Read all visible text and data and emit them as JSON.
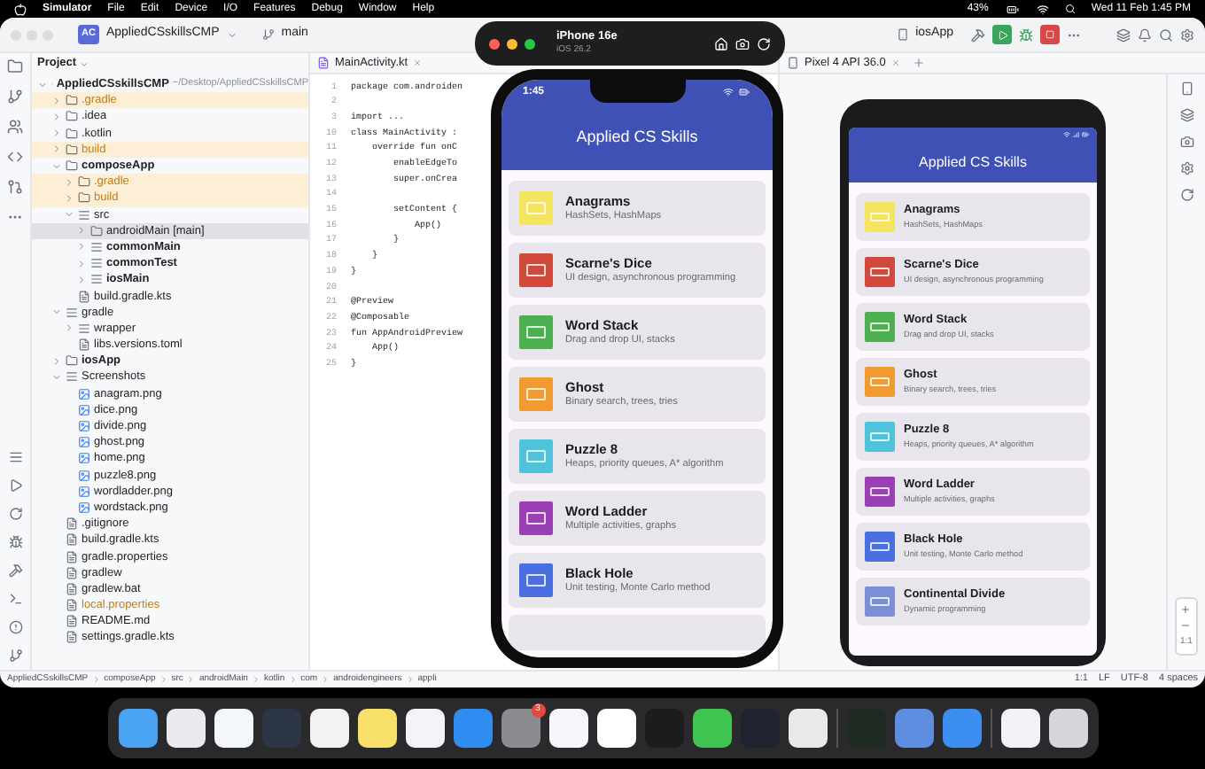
{
  "menu_bar": {
    "app": "Simulator",
    "menus": [
      "File",
      "Edit",
      "Device",
      "I/O",
      "Features",
      "Debug",
      "Window",
      "Help"
    ],
    "battery": "43%",
    "clock": "Wed 11 Feb 1:45 PM"
  },
  "ide": {
    "project_badge": "AC",
    "project": "AppliedCSskillsCMP",
    "branch": "main",
    "run_config": "iosApp",
    "project_panel": {
      "title": "Project",
      "tree": [
        {
          "label": "AppliedCSskillsCMP",
          "note": "~/Desktop/AppliedCSskillsCMP",
          "kind": "module",
          "expanded": true,
          "selected": false,
          "ignored": false,
          "children": [
            {
              "label": ".gradle",
              "kind": "folder",
              "expanded": false,
              "selected": false,
              "ignored": true
            },
            {
              "label": ".idea",
              "kind": "folder",
              "expanded": false,
              "selected": false,
              "ignored": false
            },
            {
              "label": ".kotlin",
              "kind": "folder",
              "expanded": false,
              "selected": false,
              "ignored": false
            },
            {
              "label": "build",
              "kind": "folder",
              "expanded": false,
              "selected": false,
              "ignored": true
            },
            {
              "label": "composeApp",
              "kind": "module",
              "expanded": true,
              "selected": false,
              "ignored": false,
              "children": [
                {
                  "label": ".gradle",
                  "kind": "folder",
                  "expanded": false,
                  "selected": false,
                  "ignored": true
                },
                {
                  "label": "build",
                  "kind": "folder",
                  "expanded": false,
                  "selected": false,
                  "ignored": true
                },
                {
                  "label": "src",
                  "kind": "source",
                  "expanded": true,
                  "selected": false,
                  "ignored": false,
                  "children": [
                    {
                      "label": "androidMain [main]",
                      "kind": "folder",
                      "expanded": false,
                      "selected": true,
                      "ignored": false
                    },
                    {
                      "label": "commonMain",
                      "kind": "source",
                      "expanded": false,
                      "selected": false,
                      "ignored": false
                    },
                    {
                      "label": "commonTest",
                      "kind": "source",
                      "expanded": false,
                      "selected": false,
                      "ignored": false
                    },
                    {
                      "label": "iosMain",
                      "kind": "source",
                      "expanded": false,
                      "selected": false,
                      "ignored": false
                    }
                  ]
                },
                {
                  "label": "build.gradle.kts",
                  "kind": "file",
                  "selected": false,
                  "ignored": false
                }
              ]
            },
            {
              "label": "gradle",
              "kind": "source",
              "expanded": true,
              "selected": false,
              "ignored": false,
              "children": [
                {
                  "label": "wrapper",
                  "kind": "source",
                  "expanded": false,
                  "selected": false,
                  "ignored": false
                },
                {
                  "label": "libs.versions.toml",
                  "kind": "file",
                  "selected": false,
                  "ignored": false
                }
              ]
            },
            {
              "label": "iosApp",
              "kind": "module",
              "expanded": false,
              "selected": false,
              "ignored": false
            },
            {
              "label": "Screenshots",
              "kind": "source",
              "expanded": true,
              "selected": false,
              "ignored": false,
              "children": [
                {
                  "label": "anagram.png",
                  "kind": "image",
                  "selected": false,
                  "ignored": false
                },
                {
                  "label": "dice.png",
                  "kind": "image",
                  "selected": false,
                  "ignored": false
                },
                {
                  "label": "divide.png",
                  "kind": "image",
                  "selected": false,
                  "ignored": false
                },
                {
                  "label": "ghost.png",
                  "kind": "image",
                  "selected": false,
                  "ignored": false
                },
                {
                  "label": "home.png",
                  "kind": "image",
                  "selected": false,
                  "ignored": false
                },
                {
                  "label": "puzzle8.png",
                  "kind": "image",
                  "selected": false,
                  "ignored": false
                },
                {
                  "label": "wordladder.png",
                  "kind": "image",
                  "selected": false,
                  "ignored": false
                },
                {
                  "label": "wordstack.png",
                  "kind": "image",
                  "selected": false,
                  "ignored": false
                }
              ]
            },
            {
              "label": ".gitignore",
              "kind": "file",
              "selected": false,
              "ignored": false
            },
            {
              "label": "build.gradle.kts",
              "kind": "file",
              "selected": false,
              "ignored": false
            },
            {
              "label": "gradle.properties",
              "kind": "file",
              "selected": false,
              "ignored": false
            },
            {
              "label": "gradlew",
              "kind": "file",
              "selected": false,
              "ignored": false
            },
            {
              "label": "gradlew.bat",
              "kind": "file",
              "selected": false,
              "ignored": false
            },
            {
              "label": "local.properties",
              "kind": "file",
              "selected": false,
              "ignored": true
            },
            {
              "label": "README.md",
              "kind": "file",
              "selected": false,
              "ignored": false
            },
            {
              "label": "settings.gradle.kts",
              "kind": "file",
              "selected": false,
              "ignored": false
            }
          ]
        }
      ]
    },
    "editor": {
      "tab": "MainActivity.kt",
      "lines": [
        {
          "number": "1",
          "code": "package com.androiden"
        },
        {
          "number": "2"
        },
        {
          "number": "3",
          "code": "import ..."
        },
        {
          "number": "10",
          "code": "class MainActivity :"
        },
        {
          "number": "11",
          "code": "    override fun onC"
        },
        {
          "number": "12",
          "code": "        enableEdgeTo"
        },
        {
          "number": "13",
          "code": "        super.onCrea"
        },
        {
          "number": "14"
        },
        {
          "number": "15",
          "code": "        setContent {"
        },
        {
          "number": "16",
          "code": "            App()"
        },
        {
          "number": "17",
          "code": "        }"
        },
        {
          "number": "18",
          "code": "    }"
        },
        {
          "number": "19",
          "code": "}"
        },
        {
          "number": "20"
        },
        {
          "number": "21",
          "code": "@Preview"
        },
        {
          "number": "22",
          "code": "@Composable"
        },
        {
          "number": "23",
          "code": "fun AppAndroidPreview"
        },
        {
          "number": "24",
          "code": "    App()"
        },
        {
          "number": "25",
          "code": "}"
        }
      ]
    },
    "emulator": {
      "tab": "Pixel 4 API 36.0",
      "app_title": "Applied CS Skills",
      "zoom_label": "1:1",
      "lessons": [
        {
          "title": "Anagrams",
          "subtitle": "HashSets, HashMaps",
          "color": "#f4e460"
        },
        {
          "title": "Scarne's Dice",
          "subtitle": "UI design, asynchronous programming",
          "color": "#d1493a"
        },
        {
          "title": "Word Stack",
          "subtitle": "Drag and drop UI, stacks",
          "color": "#4caf50"
        },
        {
          "title": "Ghost",
          "subtitle": "Binary search, trees, tries",
          "color": "#f09a30"
        },
        {
          "title": "Puzzle 8",
          "subtitle": "Heaps, priority queues, A* algorithm",
          "color": "#4fc3d9"
        },
        {
          "title": "Word Ladder",
          "subtitle": "Multiple activities, graphs",
          "color": "#9b3fb5"
        },
        {
          "title": "Black Hole",
          "subtitle": "Unit testing, Monte Carlo method",
          "color": "#4a6fe0"
        },
        {
          "title": "Continental Divide",
          "subtitle": "Dynamic programming",
          "color": "#7a8fd6"
        }
      ]
    },
    "status_bar": {
      "breadcrumbs": [
        "AppliedCSskillsCMP",
        "composeApp",
        "src",
        "androidMain",
        "kotlin",
        "com",
        "androidengineers",
        "appli"
      ],
      "items": [
        "1:1",
        "LF",
        "UTF-8",
        "4 spaces"
      ]
    }
  },
  "simulator": {
    "device": "iPhone 16e",
    "os": "iOS 26.2",
    "time": "1:45",
    "app_title": "Applied CS Skills",
    "lessons": [
      {
        "title": "Anagrams",
        "subtitle": "HashSets, HashMaps",
        "color": "#f4e460"
      },
      {
        "title": "Scarne's Dice",
        "subtitle": "UI design, asynchronous programming",
        "color": "#d1493a"
      },
      {
        "title": "Word Stack",
        "subtitle": "Drag and drop UI, stacks",
        "color": "#4caf50"
      },
      {
        "title": "Ghost",
        "subtitle": "Binary search, trees, tries",
        "color": "#f09a30"
      },
      {
        "title": "Puzzle 8",
        "subtitle": "Heaps, priority queues, A* algorithm",
        "color": "#4fc3d9"
      },
      {
        "title": "Word Ladder",
        "subtitle": "Multiple activities, graphs",
        "color": "#9b3fb5"
      },
      {
        "title": "Black Hole",
        "subtitle": "Unit testing, Monte Carlo method",
        "color": "#4a6fe0"
      }
    ]
  },
  "dock": {
    "badge": "3"
  }
}
